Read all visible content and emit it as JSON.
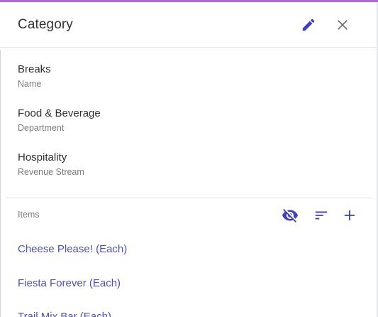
{
  "header": {
    "title": "Category",
    "edit_icon": "pencil-icon",
    "close_icon": "close-icon"
  },
  "fields": [
    {
      "value": "Breaks",
      "label": "Name"
    },
    {
      "value": "Food & Beverage",
      "label": "Department"
    },
    {
      "value": "Hospitality",
      "label": "Revenue Stream"
    }
  ],
  "items": {
    "header": "Items",
    "tools": {
      "hide_icon": "eye-off-icon",
      "sort_icon": "sort-icon",
      "add_icon": "plus-icon"
    },
    "list": [
      "Cheese Please! (Each)",
      "Fiesta Forever (Each)",
      "Trail Mix Bar (Each)"
    ]
  },
  "colors": {
    "accent": "#b06ad8",
    "icon": "#3f3fc0",
    "link": "#4a4fc4",
    "text": "#2f2f2f",
    "label": "#7a7a7a"
  }
}
